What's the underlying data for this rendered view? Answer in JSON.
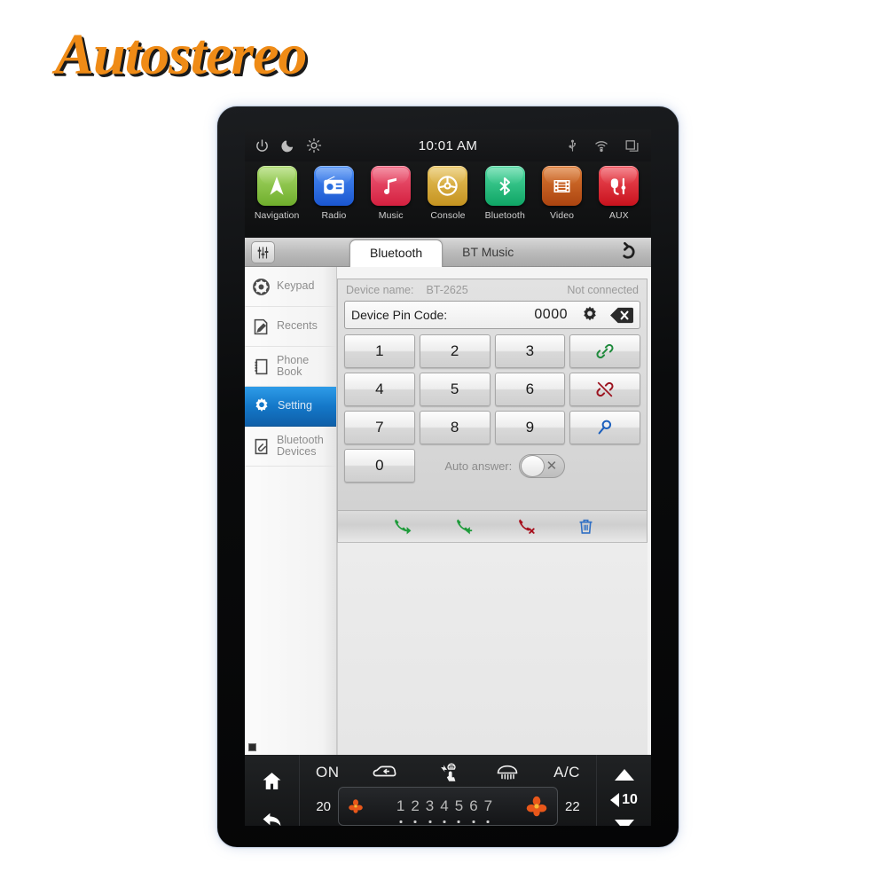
{
  "brand": {
    "logo_text": "Autostereo"
  },
  "status_bar": {
    "time": "10:01 AM",
    "left_icons": [
      "power-icon",
      "night-mode-icon",
      "brightness-icon"
    ],
    "right_icons": [
      "usb-icon",
      "wifi-icon",
      "recent-apps-icon"
    ]
  },
  "dock": {
    "items": [
      {
        "label": "Navigation",
        "icon": "navigation-arrow-icon",
        "color": "#8cc63e"
      },
      {
        "label": "Radio",
        "icon": "radio-icon",
        "color": "#2a6fe0"
      },
      {
        "label": "Music",
        "icon": "music-note-icon",
        "color": "#e03a5a"
      },
      {
        "label": "Console",
        "icon": "steering-wheel-icon",
        "color": "#d9a93a"
      },
      {
        "label": "Bluetooth",
        "icon": "bluetooth-icon",
        "color": "#20bf7a"
      },
      {
        "label": "Video",
        "icon": "film-strip-icon",
        "color": "#c5591a"
      },
      {
        "label": "AUX",
        "icon": "aux-cable-icon",
        "color": "#e0313a"
      }
    ]
  },
  "app": {
    "eq_button": "equalizer-icon",
    "back_button": "back-arrow-icon",
    "tabs": [
      {
        "label": "Bluetooth",
        "active": true
      },
      {
        "label": "BT Music",
        "active": false
      }
    ],
    "sidebar": [
      {
        "label": "Keypad",
        "icon": "dialpad-icon",
        "active": false
      },
      {
        "label": "Recents",
        "icon": "notepad-edit-icon",
        "active": false
      },
      {
        "label": "Phone Book",
        "icon": "phonebook-icon",
        "active": false
      },
      {
        "label": "Setting",
        "icon": "gear-icon",
        "active": true
      },
      {
        "label": "Bluetooth Devices",
        "icon": "link-clip-icon",
        "active": false
      }
    ],
    "panel": {
      "device_name_label": "Device name:",
      "device_name_value": "BT-2625",
      "connection_status": "Not connected",
      "pin_label": "Device Pin Code:",
      "pin_value": "0000",
      "pin_settings_icon": "gear-icon",
      "pin_backspace_icon": "backspace-icon",
      "keys": [
        "1",
        "2",
        "3",
        "4",
        "5",
        "6",
        "7",
        "8",
        "9",
        "0"
      ],
      "auto_answer_label": "Auto answer:",
      "auto_answer_state": "off",
      "auto_answer_glyph": "✕",
      "action_keys": [
        {
          "icon": "connect-link-icon",
          "color": "#1f8a3c"
        },
        {
          "icon": "disconnect-link-icon",
          "color": "#9c1420"
        },
        {
          "icon": "search-icon",
          "color": "#1b5fbd"
        }
      ]
    },
    "action_bar": [
      {
        "icon": "call-outgoing-icon",
        "color": "#1f9b3b"
      },
      {
        "icon": "call-incoming-icon",
        "color": "#1f9b3b"
      },
      {
        "icon": "call-end-icon",
        "color": "#a8121f"
      },
      {
        "icon": "trash-icon",
        "color": "#2f6fc4"
      }
    ]
  },
  "climate": {
    "home_icon": "home-icon",
    "back_icon": "back-arrow-icon",
    "power_label": "ON",
    "ac_label": "A/C",
    "mid_icons": [
      "recirculation-icon",
      "airflow-seat-icon",
      "defrost-icon"
    ],
    "temp_left": "20",
    "temp_right": "22",
    "fan_levels": [
      "1",
      "2",
      "3",
      "4",
      "5",
      "6",
      "7"
    ],
    "fan_icon_left": "fan-icon",
    "fan_icon_right": "fan-icon",
    "volume_value": "10",
    "volume_up_icon": "triangle-up-icon",
    "volume_down_icon": "triangle-down-icon",
    "speaker_icon": "speaker-icon"
  }
}
